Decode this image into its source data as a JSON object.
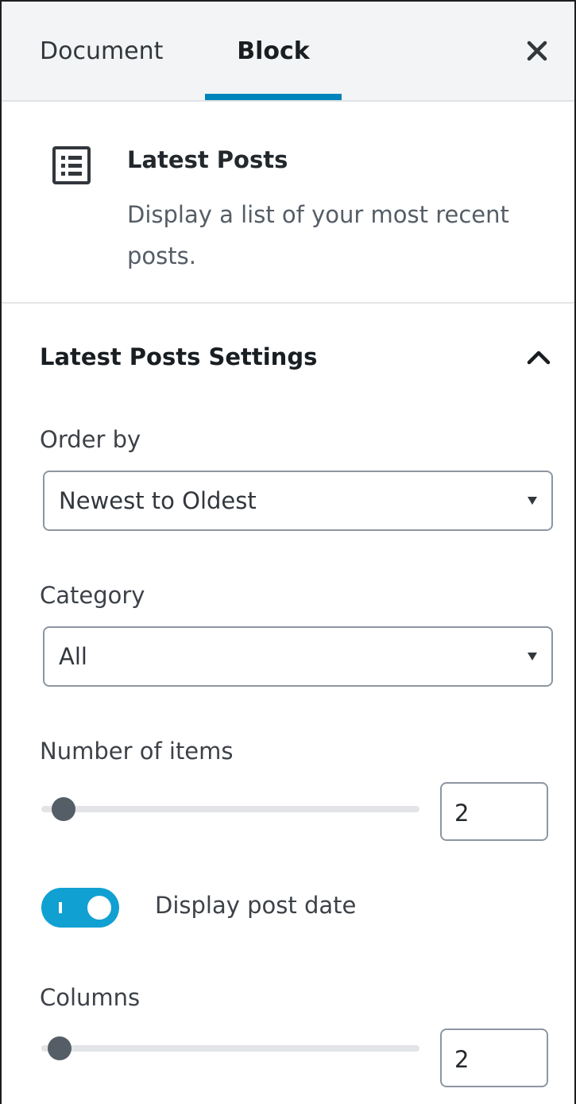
{
  "tabs": {
    "document_label": "Document",
    "block_label": "Block",
    "active": "Block"
  },
  "block": {
    "icon": "list-view-icon",
    "title": "Latest Posts",
    "description": "Display a list of your most recent posts."
  },
  "settings": {
    "title": "Latest Posts Settings",
    "expanded": true,
    "order_by": {
      "label": "Order by",
      "value": "Newest to Oldest"
    },
    "category": {
      "label": "Category",
      "value": "All"
    },
    "number_of_items": {
      "label": "Number of items",
      "value": "2"
    },
    "display_post_date": {
      "label": "Display post date",
      "enabled": true
    },
    "columns": {
      "label": "Columns",
      "value": "2"
    }
  },
  "colors": {
    "accent": "#0085ba",
    "toggle_on": "#11a0d2",
    "header_bg": "#f3f4f5"
  }
}
